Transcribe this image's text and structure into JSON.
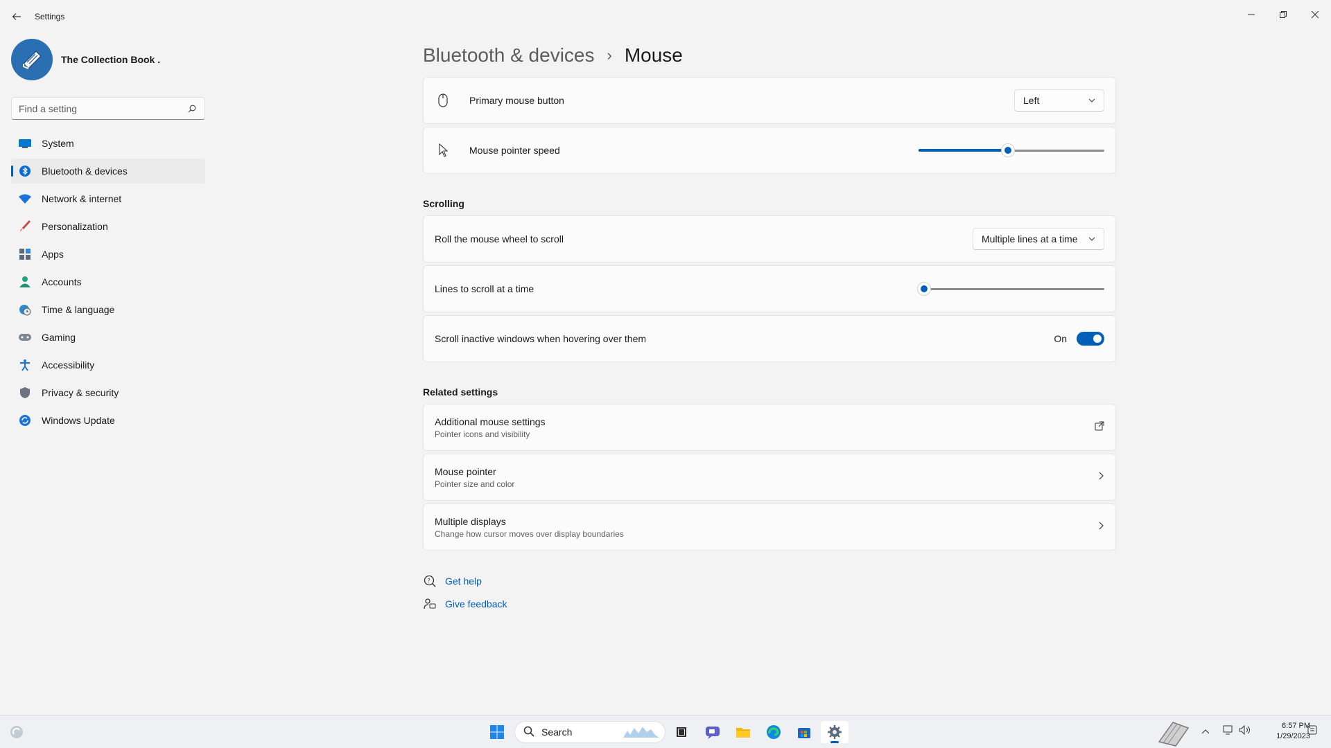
{
  "window": {
    "title": "Settings",
    "back_icon": "back-arrow-icon",
    "controls": [
      "minimize-icon",
      "restore-icon",
      "close-icon"
    ]
  },
  "profile": {
    "name": "The Collection Book ."
  },
  "search": {
    "placeholder": "Find a setting"
  },
  "nav": {
    "items": [
      {
        "label": "System",
        "icon": "monitor-icon",
        "active": false
      },
      {
        "label": "Bluetooth & devices",
        "icon": "bluetooth-icon",
        "active": true
      },
      {
        "label": "Network & internet",
        "icon": "wifi-icon",
        "active": false
      },
      {
        "label": "Personalization",
        "icon": "brush-icon",
        "active": false
      },
      {
        "label": "Apps",
        "icon": "apps-icon",
        "active": false
      },
      {
        "label": "Accounts",
        "icon": "person-icon",
        "active": false
      },
      {
        "label": "Time & language",
        "icon": "globe-clock-icon",
        "active": false
      },
      {
        "label": "Gaming",
        "icon": "gamepad-icon",
        "active": false
      },
      {
        "label": "Accessibility",
        "icon": "accessibility-icon",
        "active": false
      },
      {
        "label": "Privacy & security",
        "icon": "shield-icon",
        "active": false
      },
      {
        "label": "Windows Update",
        "icon": "update-icon",
        "active": false
      }
    ]
  },
  "breadcrumb": {
    "parent": "Bluetooth & devices",
    "separator": "›",
    "current": "Mouse"
  },
  "settings": {
    "primary_button": {
      "label": "Primary mouse button",
      "value": "Left"
    },
    "pointer_speed": {
      "label": "Mouse pointer speed",
      "level": 0.48
    },
    "scrolling_title": "Scrolling",
    "roll_wheel": {
      "label": "Roll the mouse wheel to scroll",
      "value": "Multiple lines at a time"
    },
    "lines_to_scroll": {
      "label": "Lines to scroll at a time",
      "level": 0.03
    },
    "scroll_inactive": {
      "label": "Scroll inactive windows when hovering over them",
      "state": "On",
      "on": true
    }
  },
  "related": {
    "title": "Related settings",
    "items": [
      {
        "title": "Additional mouse settings",
        "subtitle": "Pointer icons and visibility",
        "icon": "external-link-icon"
      },
      {
        "title": "Mouse pointer",
        "subtitle": "Pointer size and color",
        "icon": "chevron-right-icon"
      },
      {
        "title": "Multiple displays",
        "subtitle": "Change how cursor moves over display boundaries",
        "icon": "chevron-right-icon"
      }
    ]
  },
  "help": {
    "get_help": "Get help",
    "give_feedback": "Give feedback"
  },
  "taskbar": {
    "search_label": "Search",
    "time": "6:57 PM",
    "date": "1/29/2023"
  },
  "colors": {
    "accent": "#005fb8",
    "background": "#f3f3f3",
    "card": "#fbfbfb"
  }
}
